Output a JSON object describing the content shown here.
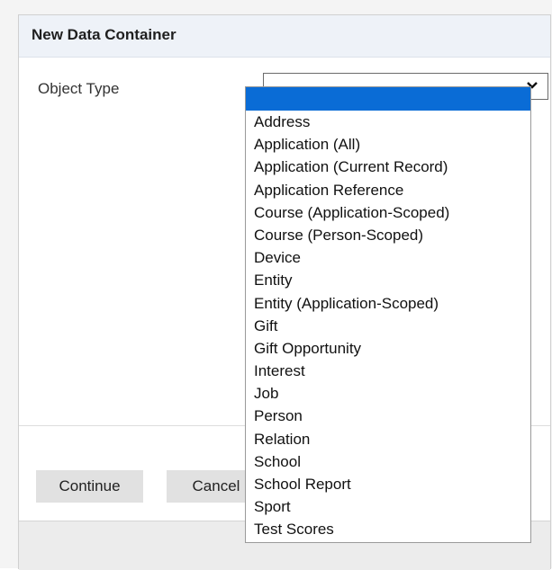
{
  "dialog": {
    "title": "New Data Container",
    "field_label": "Object Type",
    "selected_value": "",
    "options": [
      "Address",
      "Application (All)",
      "Application (Current Record)",
      "Application Reference",
      "Course (Application-Scoped)",
      "Course (Person-Scoped)",
      "Device",
      "Entity",
      "Entity (Application-Scoped)",
      "Gift",
      "Gift Opportunity",
      "Interest",
      "Job",
      "Person",
      "Relation",
      "School",
      "School Report",
      "Sport",
      "Test Scores"
    ],
    "continue_label": "Continue",
    "cancel_label": "Cancel"
  },
  "colors": {
    "highlight": "#0a6cd6",
    "header_bg": "#eef2f8",
    "button_bg": "#e1e1e1"
  },
  "icons": {
    "dropdown": "chevron-down-icon"
  }
}
